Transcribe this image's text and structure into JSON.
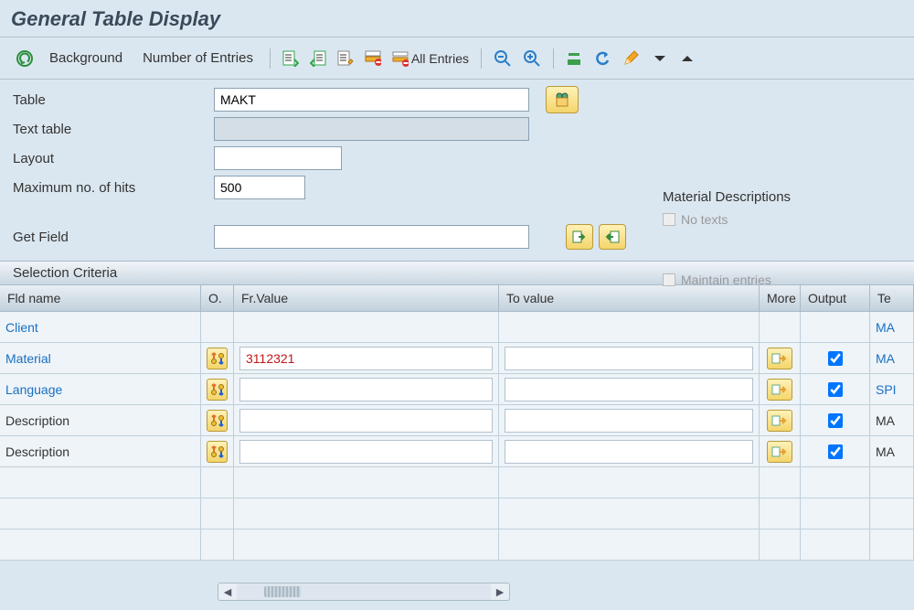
{
  "title": "General Table Display",
  "toolbar": {
    "background_label": "Background",
    "num_entries_label": "Number of Entries",
    "all_entries_label": "All Entries"
  },
  "form": {
    "labels": {
      "table": "Table",
      "text_table": "Text table",
      "layout": "Layout",
      "max_hits": "Maximum no. of hits",
      "get_field": "Get Field"
    },
    "values": {
      "table": "MAKT",
      "text_table": "",
      "layout": "",
      "max_hits": "500",
      "get_field": ""
    }
  },
  "right": {
    "heading": "Material Descriptions",
    "no_texts": "No texts",
    "maintain_entries": "Maintain entries"
  },
  "section": {
    "selection_criteria": "Selection Criteria"
  },
  "grid": {
    "headers": {
      "fld": "Fld name",
      "op": "O.",
      "from": "Fr.Value",
      "to": "To value",
      "more": "More",
      "output": "Output",
      "te": "Te"
    },
    "rows": [
      {
        "name": "Client",
        "link": true,
        "op": false,
        "from": "",
        "to": "",
        "more": false,
        "output": null,
        "te": "MA",
        "te_link": true
      },
      {
        "name": "Material",
        "link": true,
        "op": true,
        "from": "3112321",
        "to": "",
        "more": true,
        "output": true,
        "te": "MA",
        "te_link": true,
        "red": true
      },
      {
        "name": "Language",
        "link": true,
        "op": true,
        "from": "",
        "to": "",
        "more": true,
        "output": true,
        "te": "SPI",
        "te_link": true
      },
      {
        "name": "Description",
        "link": false,
        "op": true,
        "from": "",
        "to": "",
        "more": true,
        "output": true,
        "te": "MA",
        "te_link": false
      },
      {
        "name": "Description",
        "link": false,
        "op": true,
        "from": "",
        "to": "",
        "more": true,
        "output": true,
        "te": "MA",
        "te_link": false
      }
    ]
  }
}
